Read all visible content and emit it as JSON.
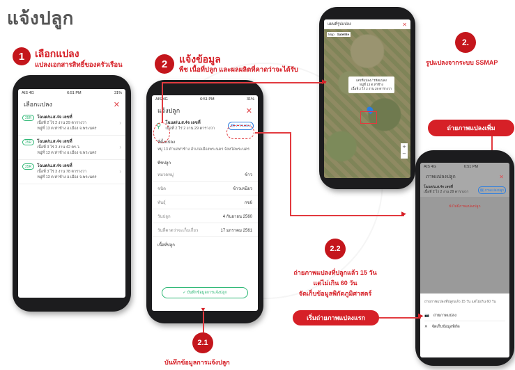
{
  "title": "แจ้งปลูก",
  "colors": {
    "accent": "#d62027",
    "badge": "#c4161c",
    "green": "#2bb673"
  },
  "step1": {
    "num": "1",
    "title": "เลือกแปลง",
    "sub": "แปลงเอกสารสิทธิ์ของครัวเรือน"
  },
  "step2": {
    "num": "2",
    "title": "แจ้งข้อมูล",
    "sub": "พืช เนื้อที่ปลูก และผลผลิตที่คาดว่าจะได้รับ"
  },
  "step2map": {
    "num": "2.",
    "label": "รูปแปลงจากระบบ SSMAP"
  },
  "step22": {
    "num": "2.2",
    "line1": "ถ่ายภาพแปลงที่ปลูกแล้ว 15 วัน",
    "line2": "แต่ไม่เกิน 60 วัน",
    "line3": "จัดเก็บข้อมูลพิกัดภูมิศาสตร์"
  },
  "step21": {
    "num": "2.1",
    "label": "บันทึกข้อมูลการแจ้งปลูก"
  },
  "pills": {
    "add_photo": "ถ่ายภาพแปลงเพิ่ม",
    "first_photo": "เริ่มถ่ายภาพแปลงแรก"
  },
  "phone1": {
    "carrier": "AIS 4G",
    "time": "6:51 PM",
    "battery": "31%",
    "title": "เลือกแปลง",
    "items": [
      {
        "badge": "25R",
        "name": "โฉนด/น.ส.4จ เลขที่",
        "area": "เนื้อที่ 2 ไร่ 2 งาน 29 ตารางวา",
        "addr": "หมู่ที่ 13 ต.ท่าช้าง อ.เมือง จ.พระนคร"
      },
      {
        "badge": "25R",
        "name": "โฉนด/น.ส.4จ เลขที่",
        "area": "เนื้อที่ 3 ไร่ 3 งาน 42 ตร.ว.",
        "addr": "หมู่ที่ 13 ต.ท่าช้าง อ.เมือง จ.พระนคร"
      },
      {
        "badge": "25R",
        "name": "โฉนด/น.ส.4จ เลขที่",
        "area": "เนื้อที่ 3 ไร่ 3 งาน 78 ตารางวา",
        "addr": "หมู่ที่ 13 ต.ท่าช้าง อ.เมือง จ.พระนคร"
      }
    ]
  },
  "phone2": {
    "carrier": "AIS 4G",
    "time": "6:51 PM",
    "battery": "31%",
    "title": "แจ้งปลูก",
    "plot_name": "โฉนด/น.ส.4จ เลขที่",
    "plot_area": "เนื้อที่ 2 ไร่ 2 งาน 29 ตารางวา",
    "map_btn": "ภาพแปลง",
    "location_label": "ที่ตั้งแปลง",
    "location_text": "หมู่ 13 ตำบลท่าช้าง อำเภอเมืองพระนคร จังหวัดพระนคร",
    "crop_label": "พืชปลูก",
    "fields": [
      {
        "label": "หมวดหมู่",
        "value": "ข้าว"
      },
      {
        "label": "ชนิด",
        "value": "ข้าวเหนียว"
      },
      {
        "label": "พันธุ์",
        "value": "กข6"
      },
      {
        "label": "วันปลูก",
        "value": "4 กันยายน 2560"
      },
      {
        "label": "วันที่คาดว่าจะเก็บเกี่ยว",
        "value": "17 มกราคม 2561"
      }
    ],
    "area_label": "เนื้อที่ปลูก",
    "save_btn": "✓ บันทึกข้อมูลการแจ้งปลูก"
  },
  "phone3": {
    "title": "แผนที่รูปแปลง",
    "tab_map": "Map",
    "tab_sat": "Satellite",
    "popup1": "เลขที่แปลง / รหัสแปลง",
    "popup2": "หมู่ที่ 13 ต.ท่าช้าง",
    "popup3": "เนื้อที่ 2 ไร่ 2 งาน 29 ตารางวา"
  },
  "phone4": {
    "carrier": "AIS 4G",
    "time": "6:51 PM",
    "title": "ภาพแปลงปลูก",
    "plot_name": "โฉนด/น.ส.4จ เลขที่",
    "plot_area": "เนื้อที่ 2 ไร่ 2 งาน 29 ตารางวา",
    "map_btn": "ภาพแปลงปลูก",
    "no_photo": "ยังไม่มีภาพแปลงปลูก",
    "sheet_title": "ถ่ายภาพแปลงที่ปลูกแล้ว 15 วัน แต่ไม่เกิน 60 วัน",
    "opt1": "ถ่ายภาพแปลง",
    "opt2": "จัดเก็บข้อมูลพิกัด"
  }
}
